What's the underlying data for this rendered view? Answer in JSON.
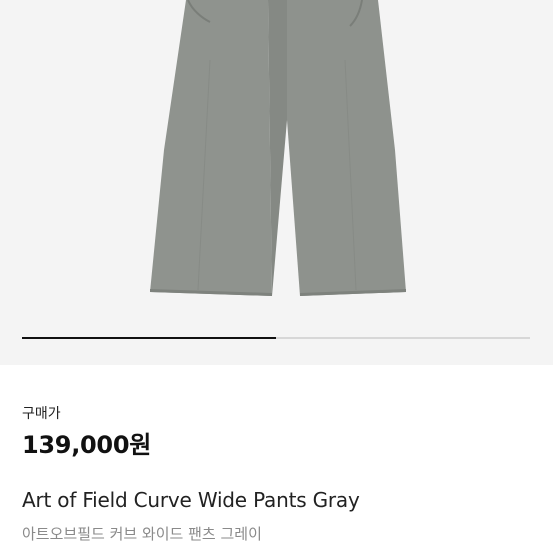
{
  "product": {
    "image_alt": "Gray wide pants product photo",
    "gallery_progress": 0.5,
    "price_label": "구매가",
    "price": "139,000원",
    "name_en": "Art of Field Curve Wide Pants Gray",
    "name_ko": "아트오브필드 커브 와이드 팬츠 그레이"
  },
  "colors": {
    "image_bg": "#f4f4f4",
    "pants": "#8f938e",
    "progress_active": "#111111",
    "progress_track": "#d7d7d7"
  }
}
